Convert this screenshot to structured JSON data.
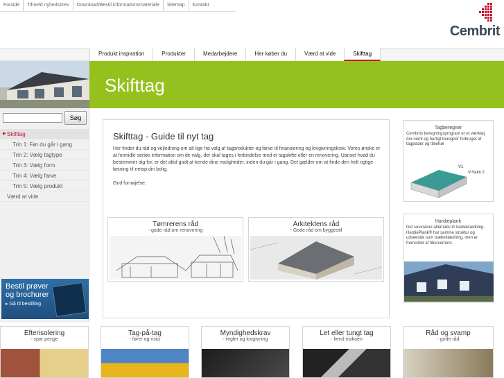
{
  "toplinks": [
    "Forside",
    "Tilmeld nyhedsbrev",
    "Download/Bestil informationsmateriale",
    "Sitemap",
    "Kontakt"
  ],
  "logo": {
    "text": "Cembrit"
  },
  "nav": [
    "Produkt inspiration",
    "Produkter",
    "Medarbejdere",
    "Her køber du",
    "Værd at vide",
    "Skifttag"
  ],
  "nav_active": "Skifttag",
  "banner": {
    "title": "Skifttag"
  },
  "search": {
    "placeholder": "",
    "button": "Søg"
  },
  "sidebar": {
    "items": [
      {
        "label": "Skifttag"
      },
      {
        "label": "Trin 1: Før du går i gang"
      },
      {
        "label": "Trin 2: Vælg tagtype"
      },
      {
        "label": "Trin 3: Vælg form"
      },
      {
        "label": "Trin 4: Vælg farve"
      },
      {
        "label": "Trin 5: Vælg produkt"
      },
      {
        "label": "Værd at vide"
      }
    ]
  },
  "bestil": {
    "line1": "Bestil prøver",
    "line2": "og brochurer",
    "link": "▸ Gå til bestilling"
  },
  "content": {
    "title": "Skifttag - Guide til nyt tag",
    "body": "Her finder du råd og vejledning om alt lige fra valg af tagprodukter og farve til finansiering og lovgivningskrav. Vores ønske er at formidle seriøs information om de valg, der skal tages i forbindelse med et tagskifte eller en renovering. Uanset hvad du bestemmer dig for, er det altid godt at kende dine muligheder, inden du går i gang. Det gælder om at finde den helt rigtige løsning til netop din bolig.",
    "greeting": "God fornøjelse."
  },
  "cards": [
    {
      "title": "Tømrerens råd",
      "sub": "- gode råd om renovering"
    },
    {
      "title": "Arkitektens råd",
      "sub": "- Gode råd om byggestil"
    }
  ],
  "right": {
    "tagberegner": {
      "title": "Tagberegner",
      "text": "Cembrits beregningsprogram er et værktøj, der nemt og hurtigt beregner forbruget af tagplader og tilbehør",
      "labels": [
        "V1",
        "V-Valm 2"
      ]
    },
    "hardieplank": {
      "title": "Hardieplank",
      "text": "Det suveræne alternativ til træbeklædning. HardiePlank® har samme struktur og udseende som træbeklædning, men er fremstillet af fibercement."
    }
  },
  "bottom": [
    {
      "title": "Efterisolering",
      "sub": "- spar penge"
    },
    {
      "title": "Tag-på-tag",
      "sub": "- fører og risici"
    },
    {
      "title": "Myndighedskrav",
      "sub": "- regler og lovgivning"
    },
    {
      "title": "Let eller tungt tag",
      "sub": "- kend risikoen"
    },
    {
      "title": "Råd og svamp",
      "sub": "- gode råd"
    }
  ]
}
